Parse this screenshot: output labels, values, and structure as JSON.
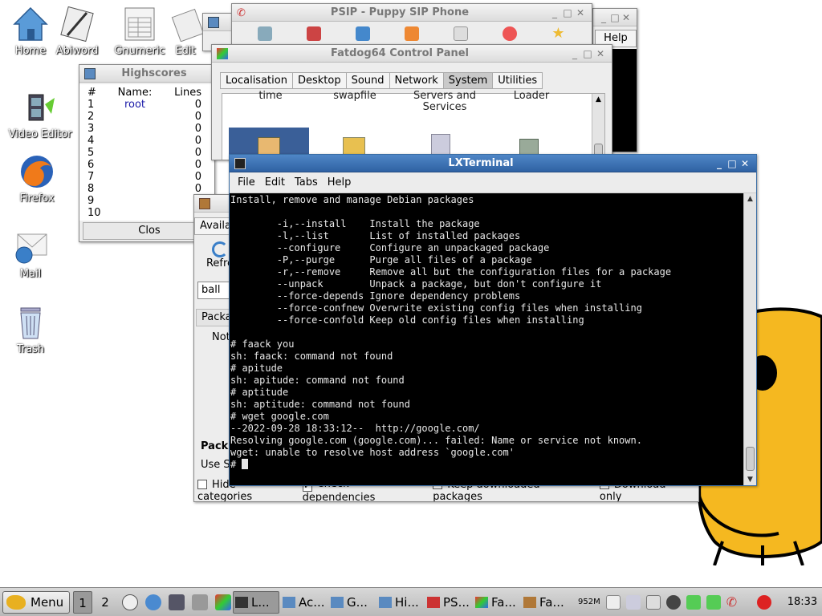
{
  "desktop": {
    "icons": [
      {
        "label": "Home"
      },
      {
        "label": "Abiword"
      },
      {
        "label": "Gnumeric"
      },
      {
        "label": "Edit"
      },
      {
        "label": "Video Editor"
      },
      {
        "label": "Firefox"
      },
      {
        "label": "Mail"
      },
      {
        "label": "Trash"
      }
    ]
  },
  "psip": {
    "title": "PSIP - Puppy SIP Phone"
  },
  "helpwin": {
    "help_label": "Help"
  },
  "control_panel": {
    "title": "Fatdog64 Control Panel",
    "tabs": [
      "Localisation",
      "Desktop",
      "Sound",
      "Network",
      "System",
      "Utilities"
    ],
    "active_tab": "System",
    "items": [
      "time",
      "swapfile",
      "Servers and Services",
      "Loader"
    ]
  },
  "highscores": {
    "title": "Highscores",
    "headers": [
      "#",
      "Name:",
      "Lines"
    ],
    "rows": [
      [
        "1",
        "root",
        "0"
      ],
      [
        "2",
        "",
        "0"
      ],
      [
        "3",
        "",
        "0"
      ],
      [
        "4",
        "",
        "0"
      ],
      [
        "5",
        "",
        "0"
      ],
      [
        "6",
        "",
        "0"
      ],
      [
        "7",
        "",
        "0"
      ],
      [
        "8",
        "",
        "0"
      ],
      [
        "9",
        "",
        "0"
      ],
      [
        "10",
        "",
        "0"
      ]
    ],
    "close_label": "Clos"
  },
  "package_manager": {
    "tab_label": "Availa",
    "refresh_label": "Refre",
    "search_value": "ball",
    "column_label": "Packa",
    "not_label": "Not",
    "section_label": "Pack",
    "use_label": "Use S",
    "options": [
      "Hide categories",
      "Check dependencies",
      "Keep downloaded packages",
      "Download only"
    ],
    "options_checked": [
      false,
      true,
      false,
      false
    ]
  },
  "terminal": {
    "title": "LXTerminal",
    "menu": [
      "File",
      "Edit",
      "Tabs",
      "Help"
    ],
    "lines": [
      "Install, remove and manage Debian packages",
      "",
      "        -i,--install    Install the package",
      "        -l,--list       List of installed packages",
      "        --configure     Configure an unpackaged package",
      "        -P,--purge      Purge all files of a package",
      "        -r,--remove     Remove all but the configuration files for a package",
      "        --unpack        Unpack a package, but don't configure it",
      "        --force-depends Ignore dependency problems",
      "        --force-confnew Overwrite existing config files when installing",
      "        --force-confold Keep old config files when installing",
      "",
      "# faack you",
      "sh: faack: command not found",
      "# apitude",
      "sh: apitude: command not found",
      "# aptitude",
      "sh: aptitude: command not found",
      "# wget google.com",
      "--2022-09-28 18:33:12--  http://google.com/",
      "Resolving google.com (google.com)... failed: Name or service not known.",
      "wget: unable to resolve host address `google.com'"
    ],
    "prompt": "# "
  },
  "taskbar": {
    "menu_label": "Menu",
    "workspaces": [
      "1",
      "2"
    ],
    "tasks": [
      "L...",
      "Ac...",
      "G...",
      "Hi...",
      "PS...",
      "Fa...",
      "Fa..."
    ],
    "memory": "952M",
    "clock": "18:33"
  }
}
